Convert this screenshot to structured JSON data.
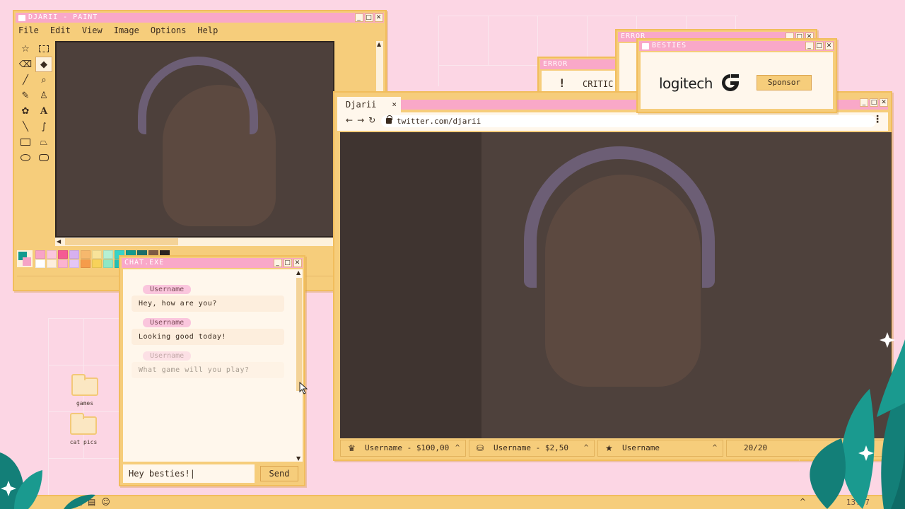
{
  "colors": {
    "desktop_bg": "#fcd6e4",
    "window_frame": "#f6cd7b",
    "titlebar": "#f9a8c8",
    "panel": "#fff7ec",
    "username_pill": "#fac6dd",
    "plant": "#137f78"
  },
  "window_buttons": {
    "minimize": "_",
    "maximize": "□",
    "close": "✕"
  },
  "paint": {
    "title": "DJARII - PAINT",
    "menu": [
      "File",
      "Edit",
      "View",
      "Image",
      "Options",
      "Help"
    ],
    "tools": [
      "free-select",
      "rect-select",
      "eraser",
      "fill-bucket",
      "color-picker",
      "magnifier",
      "pencil",
      "brush",
      "airbrush",
      "text",
      "line",
      "curve",
      "rectangle",
      "polygon",
      "ellipse",
      "rounded-rect"
    ],
    "text_tool_glyph": "A",
    "palette": [
      "#f8a3c7",
      "#fac6dd",
      "#f55b93",
      "#d7b0f0",
      "#f6b86d",
      "#f8e39a",
      "#b5f0d4",
      "#37d3c8",
      "#129a8e",
      "#1b6e6a",
      "#7e5a45",
      "#2b2320",
      "#ffffff",
      "#fdeedd",
      "#fbb3cf",
      "#e4c6f5",
      "#f59c4b",
      "#f7d25a",
      "#8fe8c5",
      "#23bfb6",
      "#0f8d83",
      "#197c78",
      "#a27c5c",
      "#3a2b1f"
    ]
  },
  "chat": {
    "title": "CHAT.EXE",
    "messages": [
      {
        "user": "Username",
        "text": "Hey, how are you?"
      },
      {
        "user": "Username",
        "text": "Looking good today!"
      },
      {
        "user": "Username",
        "text": "What game will you play?"
      }
    ],
    "input_value": "Hey besties!",
    "send_label": "Send"
  },
  "error1": {
    "title": "ERROR",
    "icon": "!",
    "text": "CRITIC"
  },
  "error2": {
    "title": "ERROR"
  },
  "besties": {
    "title": "BESTIES",
    "sponsor_name": "logitech",
    "sponsor_button": "Sponsor"
  },
  "browser": {
    "tab_label": "Djarii",
    "tab_close": "×",
    "url": "twitter.com/djarii",
    "nav": {
      "back": "←",
      "forward": "→",
      "reload": "↻",
      "menu": "⋮"
    },
    "bottom": [
      {
        "icon": "crown-icon",
        "glyph": "♛",
        "text": "Username - $100,00"
      },
      {
        "icon": "coins-icon",
        "glyph": "⛁",
        "text": "Username - $2,50"
      },
      {
        "icon": "star-icon",
        "glyph": "★",
        "text": "Username"
      }
    ],
    "counter": "20/20"
  },
  "desktop_icons": [
    {
      "label": "games"
    },
    {
      "label": "cat pics"
    }
  ],
  "taskbar": {
    "icons": [
      "folder-icon",
      "document-icon",
      "smiley-icon"
    ],
    "tray_caret": "^",
    "clock": "13:37"
  }
}
